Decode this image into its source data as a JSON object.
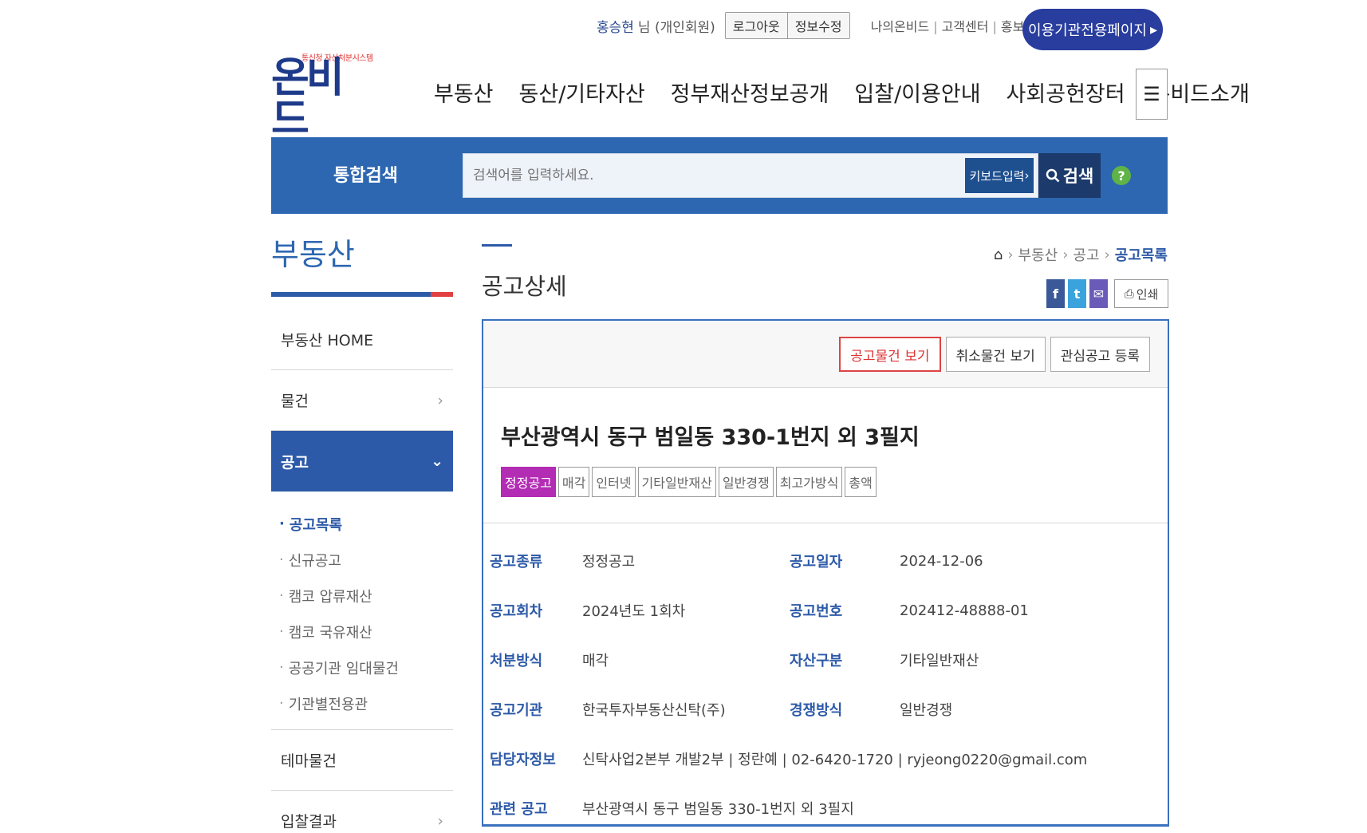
{
  "util": {
    "user_name": "홍승현",
    "user_suffix": "님 (개인회원)",
    "logout": "로그아웃",
    "edit_info": "정보수정",
    "links": [
      "나의온비드",
      "고객센터",
      "홍보마당"
    ],
    "institution_page": "이용기관전용페이지"
  },
  "logo": {
    "tagline": "통신청 자산처분시스템",
    "text": "온비드"
  },
  "gnb": [
    "부동산",
    "동산/기타자산",
    "정부재산정보공개",
    "입찰/이용안내",
    "사회공헌장터",
    "온비드소개"
  ],
  "search": {
    "title": "통합검색",
    "placeholder": "검색어를 입력하세요.",
    "keyboard": "키보드입력",
    "button": "검색",
    "help": "?"
  },
  "lnb": {
    "title": "부동산",
    "home": "부동산 HOME",
    "item_mulgeon": "물건",
    "item_gonggo": "공고",
    "sub": [
      "공고목록",
      "신규공고",
      "캠코 압류재산",
      "캠코 국유재산",
      "공공기관 임대물건",
      "기관별전용관"
    ],
    "item_thema": "테마물건",
    "item_result": "입찰결과"
  },
  "content": {
    "title": "공고상세",
    "breadcrumb": [
      "부동산",
      "공고",
      "공고목록"
    ],
    "print": "인쇄"
  },
  "detail": {
    "buttons": {
      "view_items": "공고물건 보기",
      "view_cancelled": "취소물건 보기",
      "register_interest": "관심공고 등록"
    },
    "heading": "부산광역시 동구 범일동 330-1번지 외 3필지",
    "tags": [
      "정정공고",
      "매각",
      "인터넷",
      "기타일반재산",
      "일반경쟁",
      "최고가방식",
      "총액"
    ],
    "rows": [
      {
        "label1": "공고종류",
        "value1": "정정공고",
        "label2": "공고일자",
        "value2": "2024-12-06"
      },
      {
        "label1": "공고회차",
        "value1": "2024년도 1회차",
        "label2": "공고번호",
        "value2": "202412-48888-01"
      },
      {
        "label1": "처분방식",
        "value1": "매각",
        "label2": "자산구분",
        "value2": "기타일반재산"
      },
      {
        "label1": "공고기관",
        "value1": "한국투자부동산신탁(주)",
        "label2": "경쟁방식",
        "value2": "일반경쟁"
      }
    ],
    "contact_label": "담당자정보",
    "contact_value": "신탁사업2본부 개발2부 | 정란예 | 02-6420-1720 | ryjeong0220@gmail.com",
    "related_label": "관련 공고",
    "related_value": "부산광역시 동구 범일동 330-1번지 외 3필지"
  },
  "colors": {
    "primary": "#2d67b1",
    "nav_active": "#2d5aa8",
    "tag_highlight": "#b32cb4",
    "accent_red": "#e24040"
  }
}
